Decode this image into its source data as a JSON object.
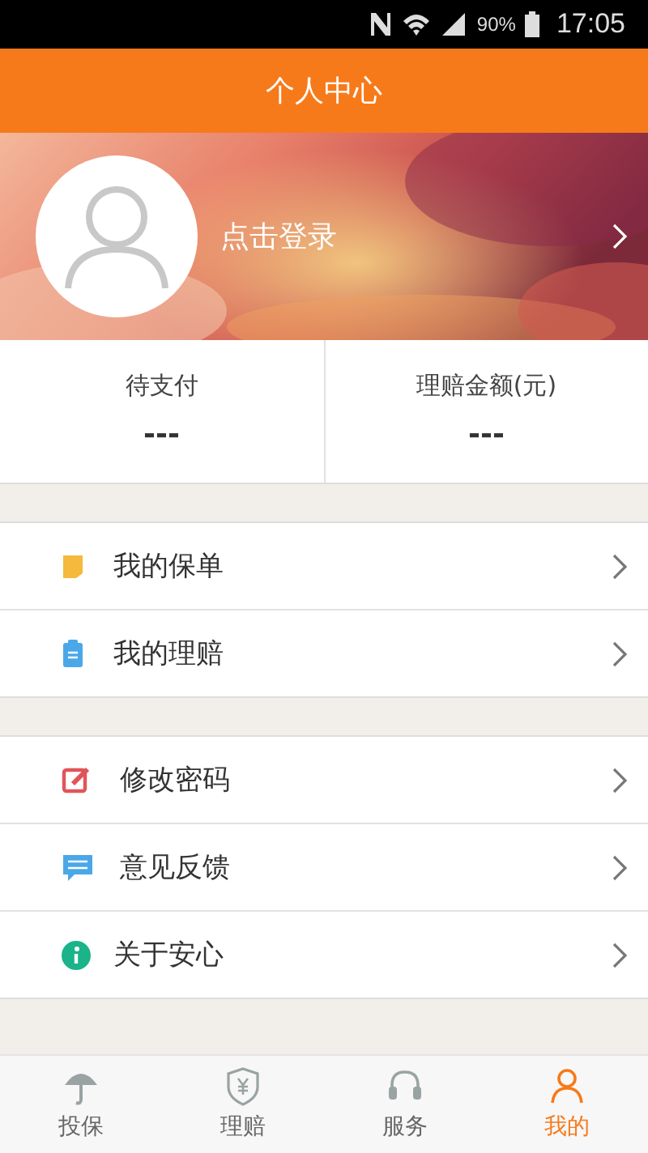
{
  "status_bar": {
    "battery": "90%",
    "time": "17:05"
  },
  "header": {
    "title": "个人中心"
  },
  "profile": {
    "login": "点击登录"
  },
  "stats": [
    {
      "label": "待支付",
      "value": "---"
    },
    {
      "label": "理赔金额(元)",
      "value": "---"
    }
  ],
  "menu_groups": [
    [
      {
        "kind": "policy",
        "label": "我的保单"
      },
      {
        "kind": "claim",
        "label": "我的理赔"
      }
    ],
    [
      {
        "kind": "password",
        "label": "修改密码"
      },
      {
        "kind": "feedback",
        "label": "意见反馈"
      },
      {
        "kind": "about",
        "label": "关于安心"
      }
    ]
  ],
  "tabs": [
    {
      "kind": "insure",
      "label": "投保",
      "selected": false
    },
    {
      "kind": "claim",
      "label": "理赔",
      "selected": false
    },
    {
      "kind": "service",
      "label": "服务",
      "selected": false
    },
    {
      "kind": "mine",
      "label": "我的",
      "selected": true
    }
  ]
}
